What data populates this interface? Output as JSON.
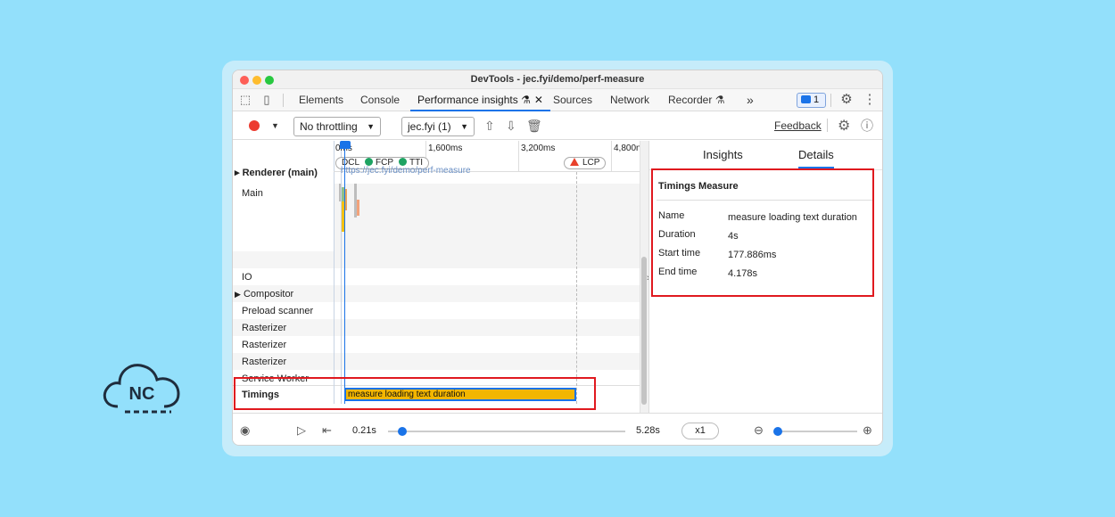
{
  "window": {
    "title": "DevTools - jec.fyi/demo/perf-measure"
  },
  "tabs": [
    {
      "label": "Elements"
    },
    {
      "label": "Console"
    },
    {
      "label": "Performance insights",
      "flask": "⚗",
      "close": "✕"
    },
    {
      "label": "Sources"
    },
    {
      "label": "Network"
    },
    {
      "label": "Recorder",
      "flask": "⚗"
    }
  ],
  "tabs_more": "»",
  "issues_badge": "1",
  "toolbar": {
    "throttling": "No throttling",
    "recording": "jec.fyi (1)",
    "feedback": "Feedback"
  },
  "ruler": {
    "ticks": [
      "0ms",
      "1,600ms",
      "3,200ms",
      "4,800n"
    ],
    "markers": [
      "DCL",
      "FCP",
      "TTI",
      "LCP"
    ]
  },
  "tracks": {
    "renderer": "▸ Renderer (main)",
    "renderer_url": "https://jec.fyi/demo/perf-measure",
    "main": "Main",
    "io": "IO",
    "compositor": "Compositor",
    "preload": "Preload scanner",
    "raster1": "Rasterizer",
    "raster2": "Rasterizer",
    "raster3": "Rasterizer",
    "service_worker": "Service Worker",
    "timings": "Timings",
    "timings_bar": "measure loading text duration"
  },
  "sidebar": {
    "tab_insights": "Insights",
    "tab_details": "Details",
    "details_title": "Timings Measure",
    "rows": [
      {
        "key": "Name",
        "value": "measure loading text duration"
      },
      {
        "key": "Duration",
        "value": "4s"
      },
      {
        "key": "Start time",
        "value": "177.886ms"
      },
      {
        "key": "End time",
        "value": "4.178s"
      }
    ]
  },
  "footer": {
    "start": "0.21s",
    "end": "5.28s",
    "speed": "x1",
    "playback_progress": 0.03,
    "zoom_level": 0.03
  },
  "logo": {
    "text": "NC"
  },
  "colors": {
    "accent": "#1a73e8",
    "highlight": "#e0191f",
    "timing_bar": "#f3b600",
    "background": "#93e0fb"
  }
}
